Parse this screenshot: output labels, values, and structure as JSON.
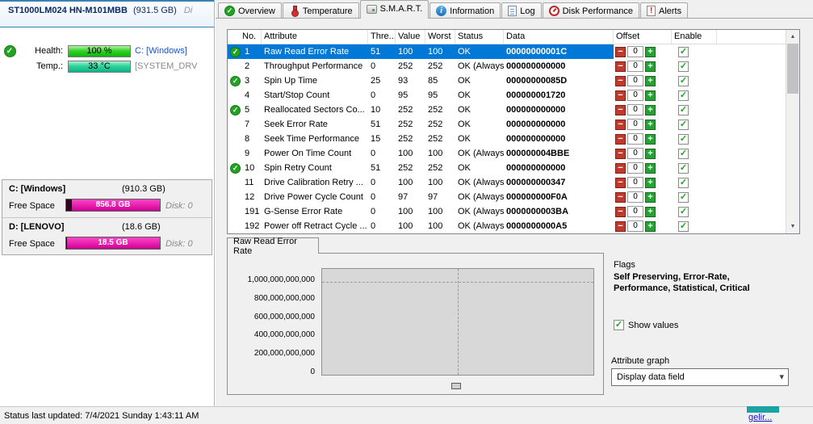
{
  "colors": {
    "selection": "#0078d7",
    "health_bar": "#35d428",
    "temp_bar": "#2bd49a",
    "free_space_bar": "#e0009e",
    "ok_check": "#24a224",
    "offset_minus": "#c0392b",
    "offset_plus": "#27a035"
  },
  "left_panel": {
    "drive": {
      "name": "ST1000LM024 HN-M101MBB",
      "size": "(931.5 GB)",
      "suffix": "Di",
      "health_label": "Health:",
      "health_value": "100 %",
      "health_volume": "C: [Windows]",
      "temp_label": "Temp.:",
      "temp_value": "33 °C",
      "temp_volume": "[SYSTEM_DRV"
    },
    "volumes": [
      {
        "name": "C: [Windows]",
        "size": "(910.3 GB)",
        "free_label": "Free Space",
        "free_value": "856.8 GB",
        "disk_label": "Disk: 0",
        "fill_pct": 94
      },
      {
        "name": "D: [LENOVO]",
        "size": "(18.6 GB)",
        "free_label": "Free Space",
        "free_value": "18.5 GB",
        "disk_label": "Disk: 0",
        "fill_pct": 99
      }
    ]
  },
  "tabs": [
    {
      "label": "Overview"
    },
    {
      "label": "Temperature"
    },
    {
      "label": "S.M.A.R.T.",
      "active": true
    },
    {
      "label": "Information"
    },
    {
      "label": "Log"
    },
    {
      "label": "Disk Performance"
    },
    {
      "label": "Alerts"
    }
  ],
  "smart_table": {
    "headers": [
      "No.",
      "Attribute",
      "Thre...",
      "Value",
      "Worst",
      "Status",
      "Data",
      "Offset",
      "Enable"
    ],
    "rows": [
      {
        "check": true,
        "no": "1",
        "attribute": "Raw Read Error Rate",
        "threshold": "51",
        "value": "100",
        "worst": "100",
        "status": "OK",
        "data": "00000000001C",
        "offset": "0",
        "enabled": true,
        "selected": true
      },
      {
        "check": false,
        "no": "2",
        "attribute": "Throughput Performance",
        "threshold": "0",
        "value": "252",
        "worst": "252",
        "status": "OK (Always...",
        "data": "000000000000",
        "offset": "0",
        "enabled": true
      },
      {
        "check": true,
        "no": "3",
        "attribute": "Spin Up Time",
        "threshold": "25",
        "value": "93",
        "worst": "85",
        "status": "OK",
        "data": "00000000085D",
        "offset": "0",
        "enabled": true
      },
      {
        "check": false,
        "no": "4",
        "attribute": "Start/Stop Count",
        "threshold": "0",
        "value": "95",
        "worst": "95",
        "status": "OK",
        "data": "000000001720",
        "offset": "0",
        "enabled": true
      },
      {
        "check": true,
        "no": "5",
        "attribute": "Reallocated Sectors Co...",
        "threshold": "10",
        "value": "252",
        "worst": "252",
        "status": "OK",
        "data": "000000000000",
        "offset": "0",
        "enabled": true
      },
      {
        "check": false,
        "no": "7",
        "attribute": "Seek Error Rate",
        "threshold": "51",
        "value": "252",
        "worst": "252",
        "status": "OK",
        "data": "000000000000",
        "offset": "0",
        "enabled": true
      },
      {
        "check": false,
        "no": "8",
        "attribute": "Seek Time Performance",
        "threshold": "15",
        "value": "252",
        "worst": "252",
        "status": "OK",
        "data": "000000000000",
        "offset": "0",
        "enabled": true
      },
      {
        "check": false,
        "no": "9",
        "attribute": "Power On Time Count",
        "threshold": "0",
        "value": "100",
        "worst": "100",
        "status": "OK (Always...",
        "data": "000000004BBE",
        "offset": "0",
        "enabled": true
      },
      {
        "check": true,
        "no": "10",
        "attribute": "Spin Retry Count",
        "threshold": "51",
        "value": "252",
        "worst": "252",
        "status": "OK",
        "data": "000000000000",
        "offset": "0",
        "enabled": true
      },
      {
        "check": false,
        "no": "11",
        "attribute": "Drive Calibration Retry ...",
        "threshold": "0",
        "value": "100",
        "worst": "100",
        "status": "OK (Always...",
        "data": "000000000347",
        "offset": "0",
        "enabled": true
      },
      {
        "check": false,
        "no": "12",
        "attribute": "Drive Power Cycle Count",
        "threshold": "0",
        "value": "97",
        "worst": "97",
        "status": "OK (Always...",
        "data": "000000000F0A",
        "offset": "0",
        "enabled": true
      },
      {
        "check": false,
        "no": "191",
        "attribute": "G-Sense Error Rate",
        "threshold": "0",
        "value": "100",
        "worst": "100",
        "status": "OK (Always...",
        "data": "0000000003BA",
        "offset": "0",
        "enabled": true
      },
      {
        "check": false,
        "no": "192",
        "attribute": "Power off Retract Cycle ...",
        "threshold": "0",
        "value": "100",
        "worst": "100",
        "status": "OK (Always...",
        "data": "0000000000A5",
        "offset": "0",
        "enabled": true
      }
    ]
  },
  "detail": {
    "tab_label": "Raw Read Error Rate",
    "flags_label": "Flags",
    "flags_value": "Self Preserving, Error-Rate, Performance, Statistical, Critical",
    "show_values_label": "Show values",
    "show_values_checked": true,
    "attribute_graph_label": "Attribute graph",
    "graph_mode_value": "Display data field",
    "chart": {
      "type": "line",
      "title": "Raw Read Error Rate",
      "y_ticks": [
        "1,000,000,000,000",
        "800,000,000,000",
        "600,000,000,000",
        "400,000,000,000",
        "200,000,000,000",
        "0"
      ],
      "ylim": [
        0,
        1000000000000
      ],
      "series": [],
      "grid": "dashed"
    }
  },
  "status_bar": {
    "text": "Status last updated: 7/4/2021 Sunday 1:43:11 AM"
  },
  "artifact": {
    "text": "gelir..."
  }
}
